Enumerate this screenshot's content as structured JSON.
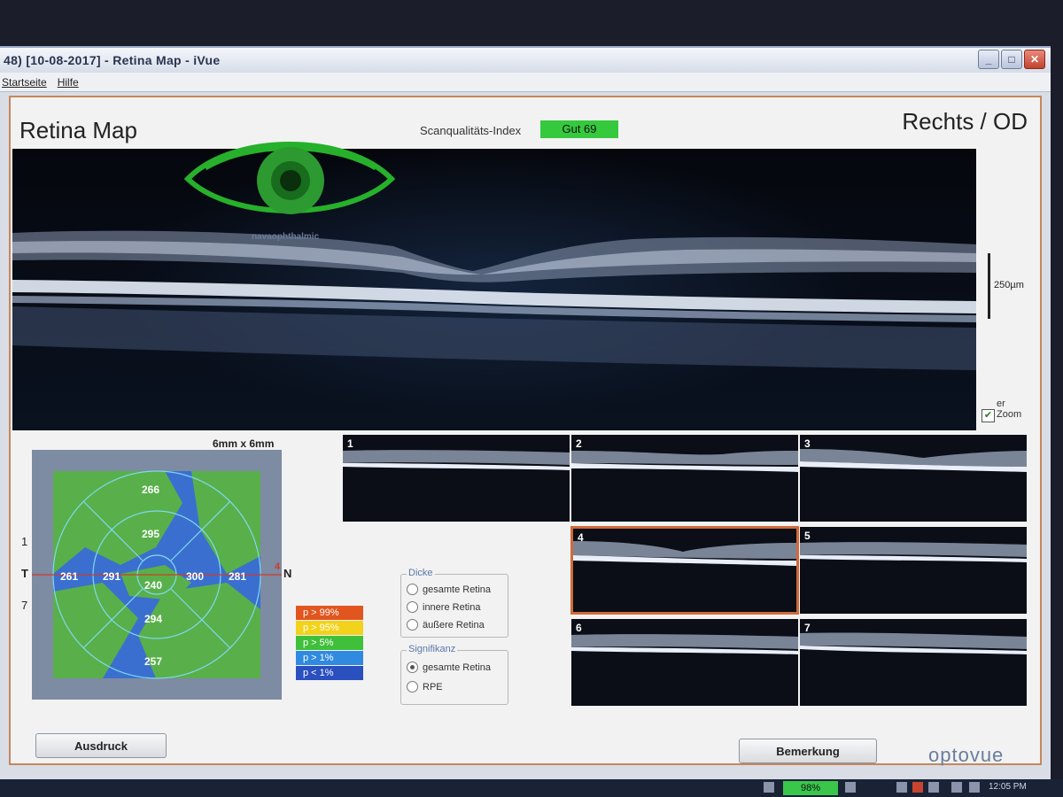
{
  "window": {
    "title": "48)  [10-08-2017]  - Retina Map - iVue",
    "controls": {
      "minimize": "_",
      "maximize": "□",
      "close": "✕"
    }
  },
  "menu": {
    "items": [
      "Startseite",
      "Hilfe"
    ]
  },
  "header": {
    "title": "Retina Map",
    "eye": "Rechts / OD",
    "scan_quality_label": "Scanqualitäts-Index",
    "scan_quality_value": "Gut  69"
  },
  "logo": {
    "text": "navaophthalmic"
  },
  "scan": {
    "scale_label": "250µm",
    "zoom_label": "er\nZoom",
    "zoom_checked": true
  },
  "map": {
    "dimension": "6mm x 6mm",
    "axis": {
      "temporal": "T",
      "nasal": "N",
      "line_top": "1",
      "line_bottom": "7",
      "marker": "4"
    },
    "values": {
      "superior_outer": "266",
      "superior_inner": "295",
      "temporal_outer": "261",
      "temporal_inner": "291",
      "center": "240",
      "nasal_inner": "300",
      "nasal_outer": "281",
      "inferior_inner": "294",
      "inferior_outer": "257"
    }
  },
  "legend": [
    {
      "label": "p > 99%",
      "color": "#e1551f"
    },
    {
      "label": "p > 95%",
      "color": "#f2d21a"
    },
    {
      "label": "p > 5%",
      "color": "#3fbf3a"
    },
    {
      "label": "p > 1%",
      "color": "#2f8ae0"
    },
    {
      "label": "p < 1%",
      "color": "#2a4fbf"
    }
  ],
  "dicke": {
    "title": "Dicke",
    "options": [
      {
        "label": "gesamte Retina",
        "selected": false
      },
      {
        "label": "innere Retina",
        "selected": false
      },
      {
        "label": "äußere Retina",
        "selected": false
      }
    ]
  },
  "signifikanz": {
    "title": "Signifikanz",
    "options": [
      {
        "label": "gesamte Retina",
        "selected": true
      },
      {
        "label": "RPE",
        "selected": false
      }
    ]
  },
  "thumbnails": [
    "1",
    "2",
    "3",
    "4",
    "5",
    "6",
    "7"
  ],
  "selected_thumbnail": "4",
  "buttons": {
    "print": "Ausdruck",
    "remark": "Bemerkung"
  },
  "brand": "optovue",
  "taskbar": {
    "battery": "98%",
    "time": "12:05 PM"
  }
}
